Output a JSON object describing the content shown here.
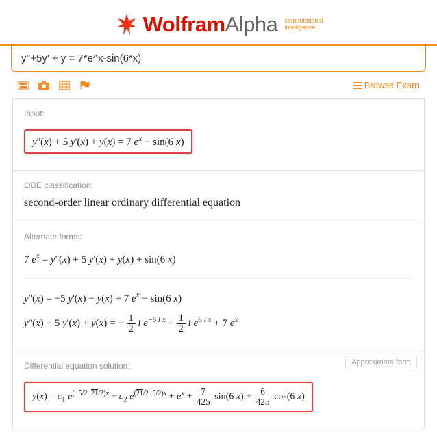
{
  "header": {
    "logo_strong": "Wolfram",
    "logo_light": "Alpha",
    "tagline1": "computational",
    "tagline2": "intelligence."
  },
  "search": {
    "query": "y''+5y' + y = 7*e^x-sin(6*x)"
  },
  "toolbar": {
    "browse_label": "Browse Exam"
  },
  "pods": {
    "input": {
      "title": "Input:",
      "formula": "y''(x) + 5 y'(x) + y(x) = 7 eˣ − sin(6 x)"
    },
    "classification": {
      "title": "ODE classification:",
      "text": "second-order linear ordinary differential equation"
    },
    "alternate": {
      "title": "Alternate forms:",
      "f1": "7 eˣ = y''(x) + 5 y'(x) + y(x) + sin(6 x)",
      "f2": "y''(x) = −5 y'(x) − y(x) + 7 eˣ − sin(6 x)",
      "f3_lhs": "y''(x) + 5 y'(x) + y(x) = ",
      "f3_a": "− ",
      "f3_num1": "1",
      "f3_den1": "2",
      "f3_mid1": " i e",
      "f3_exp1": "−6 i x",
      "f3_plus": " + ",
      "f3_num2": "1",
      "f3_den2": "2",
      "f3_mid2": " i e",
      "f3_exp2": "6 i x",
      "f3_end": " + 7 eˣ"
    },
    "solution": {
      "title": "Differential equation solution:",
      "approx_label": "Approximate form",
      "sol_start": "y(x) = c₁ e",
      "sol_exp1a": "(−5/2−",
      "sol_exp1b": "21",
      "sol_exp1c": "/2)x",
      "sol_mid1": " + c₂ e",
      "sol_exp2a": "(",
      "sol_exp2b": "21",
      "sol_exp2c": "/2−5/2)x",
      "sol_mid2": " + eˣ + ",
      "sol_num1": "7",
      "sol_den1": "425",
      "sol_sin": " sin(6 x) + ",
      "sol_num2": "6",
      "sol_den2": "425",
      "sol_cos": " cos(6 x)"
    }
  }
}
